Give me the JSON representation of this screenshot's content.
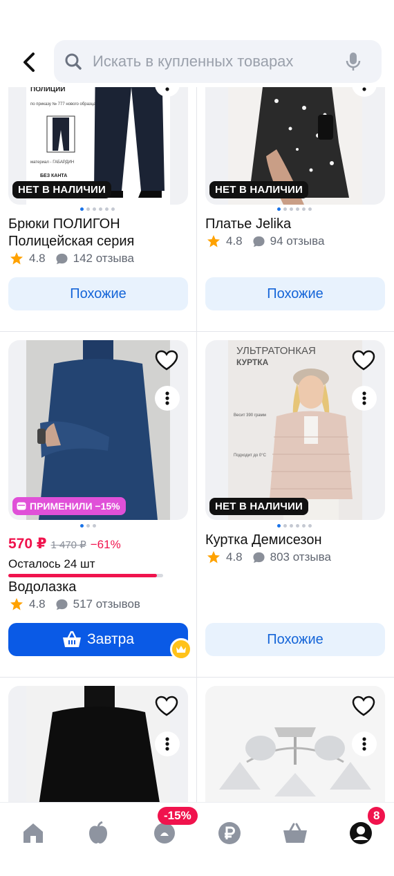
{
  "search": {
    "placeholder": "Искать в купленных товарах"
  },
  "badges": {
    "out_of_stock": "НЕТ В НАЛИЧИИ",
    "sale": "ПРИМЕНИЛИ −15%"
  },
  "products": [
    {
      "title": "Брюки ПОЛИГОН Полицейская серия",
      "rating": "4.8",
      "reviews": "142 отзыва",
      "button": "Похожие",
      "image_text": [
        "ПОЛИЦИИ",
        "по приказу № 777 нового образца",
        "материал - ГАБАРДИН",
        "БЕЗ КАНТА"
      ]
    },
    {
      "title": "Платье Jelika",
      "rating": "4.8",
      "reviews": "94 отзыва",
      "button": "Похожие"
    },
    {
      "title": "Водолазка",
      "rating": "4.8",
      "reviews": "517 отзывов",
      "price": "570 ₽",
      "old_price": "1 470 ₽",
      "discount": "−61%",
      "stock": "Осталось 24 шт",
      "stock_fraction": 0.96,
      "button": "Завтра"
    },
    {
      "title": "Куртка Демисезон",
      "rating": "4.8",
      "reviews": "803 отзыва",
      "button": "Похожие",
      "image_text": [
        "УЛЬТРАТОНКАЯ",
        "КУРТКА",
        "Весит 390 грамм",
        "Подходит до 0°C"
      ]
    }
  ],
  "nav": {
    "promo_badge": "-15%",
    "profile_badge": "8"
  },
  "icons": [
    "back-arrow",
    "search",
    "microphone",
    "heart",
    "more-vertical",
    "star",
    "comment",
    "basket",
    "crown",
    "home",
    "apple",
    "sale-bag",
    "ruble",
    "cart",
    "profile"
  ],
  "colors": {
    "accent": "#0a5ae6",
    "price": "#f0134d",
    "star": "#ffa200",
    "sale_badge": "#e050d8"
  }
}
